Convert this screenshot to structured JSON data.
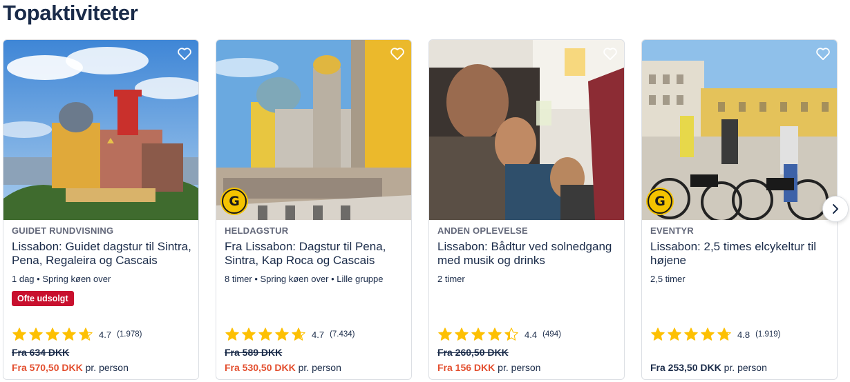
{
  "section": {
    "title": "Topaktiviteter"
  },
  "colors": {
    "accent": "#e34f2f",
    "badge": "#c8102e",
    "star": "#fdc003",
    "text": "#1a2b49"
  },
  "cards": [
    {
      "category": "GUIDET RUNDVISNING",
      "title": "Lissabon: Guidet dagstur til Sintra, Pena, Regaleira og Cascais",
      "meta": "1 dag • Spring køen over",
      "badge": "Ofte udsolgt",
      "rating": 4.7,
      "rating_value": "4.7",
      "rating_count": "(1.978)",
      "old_price": "Fra 634 DKK",
      "price": "Fra 570,50 DKK",
      "per": "pr. person",
      "g_badge": false,
      "heart_icon": "heart-outline-icon"
    },
    {
      "category": "HELDAGSTUR",
      "title": "Fra Lissabon: Dagstur til Pena, Sintra, Kap Roca og Cascais",
      "meta": "8 timer • Spring køen over • Lille gruppe",
      "badge": "",
      "rating": 4.7,
      "rating_value": "4.7",
      "rating_count": "(7.434)",
      "old_price": "Fra 589 DKK",
      "price": "Fra 530,50 DKK",
      "per": "pr. person",
      "g_badge": true,
      "heart_icon": "heart-outline-icon"
    },
    {
      "category": "ANDEN OPLEVELSE",
      "title": "Lissabon: Bådtur ved solnedgang med musik og drinks",
      "meta": "2 timer",
      "badge": "",
      "rating": 4.4,
      "rating_value": "4.4",
      "rating_count": "(494)",
      "old_price": "Fra 260,50 DKK",
      "price": "Fra 156 DKK",
      "per": "pr. person",
      "g_badge": false,
      "heart_icon": "heart-outline-icon"
    },
    {
      "category": "EVENTYR",
      "title": "Lissabon: 2,5 times elcykeltur til højene",
      "meta": "2,5 timer",
      "badge": "",
      "rating": 4.8,
      "rating_value": "4.8",
      "rating_count": "(1.919)",
      "old_price": "",
      "price": "Fra 253,50 DKK",
      "per": "pr. person",
      "g_badge": true,
      "heart_icon": "heart-outline-icon"
    }
  ],
  "g_badge_letter": "G",
  "carousel": {
    "next_icon": "chevron-right-icon"
  }
}
